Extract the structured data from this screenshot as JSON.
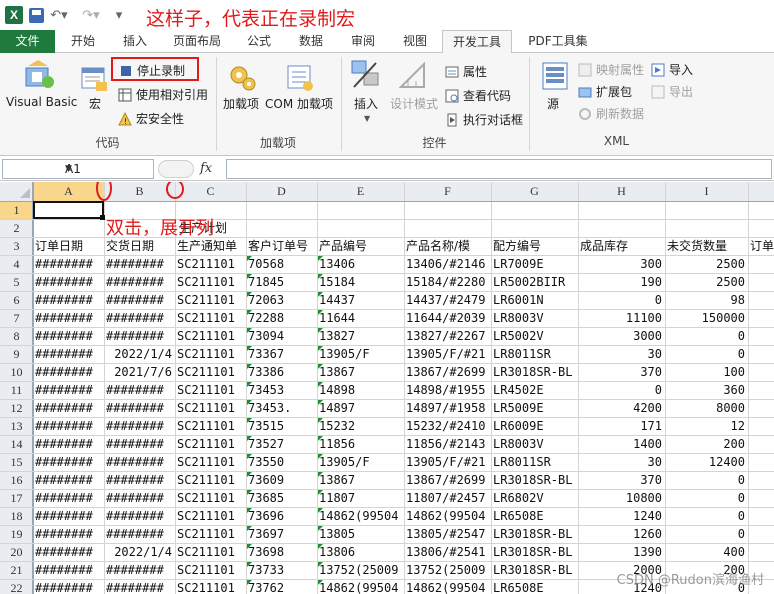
{
  "annotations": {
    "title_note": "这样子，代表正在录制宏",
    "grid_note": "双击，展开列",
    "watermark": "CSDN @Rudon滨海渔村"
  },
  "quick_access": {
    "app_icon": "X",
    "undo_icon": "undo-icon",
    "redo_icon": "redo-icon"
  },
  "tabs": [
    "文件",
    "开始",
    "插入",
    "页面布局",
    "公式",
    "数据",
    "审阅",
    "视图",
    "开发工具",
    "PDF工具集"
  ],
  "active_tab": "开发工具",
  "ribbon": {
    "vb": "Visual Basic",
    "macros": "宏",
    "stop_recording": "停止录制",
    "relative_ref": "使用相对引用",
    "macro_security": "宏安全性",
    "group_code": "代码",
    "addins": "加载项",
    "com_addins": "COM 加载项",
    "group_addins": "加载项",
    "insert": "插入",
    "design_mode": "设计模式",
    "properties": "属性",
    "view_code": "查看代码",
    "run_dialog": "执行对话框",
    "group_controls": "控件",
    "source": "源",
    "map_props": "映射属性",
    "expansion_packs": "扩展包",
    "refresh_data": "刷新数据",
    "import": "导入",
    "export": "导出",
    "group_xml": "XML"
  },
  "formula_bar": {
    "name_box": "A1",
    "fx": "fx",
    "value": ""
  },
  "columns": [
    "A",
    "B",
    "C",
    "D",
    "E",
    "F",
    "G",
    "H",
    "I"
  ],
  "row_numbers": [
    "1",
    "2",
    "3",
    "4",
    "5",
    "6",
    "7",
    "8",
    "9",
    "10",
    "11",
    "12",
    "13",
    "14",
    "15",
    "16",
    "17",
    "18",
    "19",
    "20",
    "21",
    "22"
  ],
  "row2_title": "生产计划",
  "headers": [
    "订单日期",
    "交货日期",
    "生产通知单",
    "客户订单号",
    "产品编号",
    "产品名称/模",
    "配方编号",
    "成品库存",
    "未交货数量",
    "订单"
  ],
  "rows": [
    [
      "########",
      "########",
      "SC211101",
      "70568",
      "13406",
      "13406/#2146",
      "LR7009E",
      "300",
      "2500"
    ],
    [
      "########",
      "########",
      "SC211101",
      "71845",
      "15184",
      "15184/#2280",
      "LR5002BIIR",
      "190",
      "2500"
    ],
    [
      "########",
      "########",
      "SC211101",
      "72063",
      "14437",
      "14437/#2479",
      "LR6001N",
      "0",
      "98"
    ],
    [
      "########",
      "########",
      "SC211101",
      "72288",
      "11644",
      "11644/#2039",
      "LR8003V",
      "11100",
      "150000"
    ],
    [
      "########",
      "########",
      "SC211101",
      "73094",
      "13827",
      "13827/#2267",
      "LR5002V",
      "3000",
      "0"
    ],
    [
      "########",
      "2022/1/4",
      "SC211101",
      "73367",
      "13905/F",
      "13905/F/#21",
      "LR8011SR",
      "30",
      "0"
    ],
    [
      "########",
      "2021/7/6",
      "SC211101",
      "73386",
      "13867",
      "13867/#2699",
      "LR3018SR-BL",
      "370",
      "100"
    ],
    [
      "########",
      "########",
      "SC211101",
      "73453",
      "14898",
      "14898/#1955",
      "LR4502E",
      "0",
      "360"
    ],
    [
      "########",
      "########",
      "SC211101",
      "73453.",
      "14897",
      "14897/#1958",
      "LR5009E",
      "4200",
      "8000"
    ],
    [
      "########",
      "########",
      "SC211101",
      "73515",
      "15232",
      "15232/#2410",
      "LR6009E",
      "171",
      "12"
    ],
    [
      "########",
      "########",
      "SC211101",
      "73527",
      "11856",
      "11856/#2143",
      "LR8003V",
      "1400",
      "200"
    ],
    [
      "########",
      "########",
      "SC211101",
      "73550",
      "13905/F",
      "13905/F/#21",
      "LR8011SR",
      "30",
      "12400"
    ],
    [
      "########",
      "########",
      "SC211101",
      "73609",
      "13867",
      "13867/#2699",
      "LR3018SR-BL",
      "370",
      "0"
    ],
    [
      "########",
      "########",
      "SC211101",
      "73685",
      "11807",
      "11807/#2457",
      "LR6802V",
      "10800",
      "0"
    ],
    [
      "########",
      "########",
      "SC211101",
      "73696",
      "14862(99504",
      "14862(99504",
      "LR6508E",
      "1240",
      "0"
    ],
    [
      "########",
      "########",
      "SC211101",
      "73697",
      "13805",
      "13805/#2547",
      "LR3018SR-BL",
      "1260",
      "0"
    ],
    [
      "########",
      "2022/1/4",
      "SC211101",
      "73698",
      "13806",
      "13806/#2541",
      "LR3018SR-BL",
      "1390",
      "400"
    ],
    [
      "########",
      "########",
      "SC211101",
      "73733",
      "13752(25009",
      "13752(25009",
      "LR3018SR-BL",
      "2000",
      "200"
    ],
    [
      "########",
      "########",
      "SC211101",
      "73762",
      "14862(99504",
      "14862(99504",
      "LR6508E",
      "1240",
      "0"
    ]
  ],
  "colors": {
    "annotation": "#e31a1a",
    "file_tab": "#1f7a3d",
    "selected_col": "#f8d78d"
  }
}
